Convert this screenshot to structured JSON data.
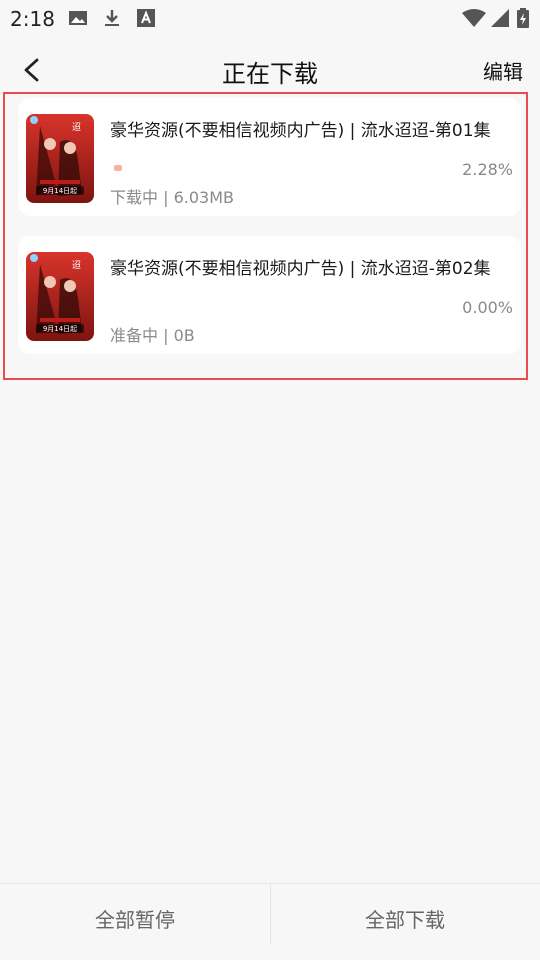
{
  "status_bar": {
    "time": "2:18",
    "icons": [
      "image-icon",
      "download-icon",
      "text-icon",
      "wifi-icon",
      "signal-icon",
      "battery-icon"
    ]
  },
  "header": {
    "title": "正在下载",
    "edit_label": "编辑",
    "back_icon": "chevron-left-icon"
  },
  "downloads": [
    {
      "title": "豪华资源(不要相信视频内广告) | 流水迢迢-第01集",
      "percent": "2.28%",
      "progress_fraction": 0.0228,
      "status": "下载中 | 6.03MB",
      "poster_badge": "9月14日起"
    },
    {
      "title": "豪华资源(不要相信视频内广告) | 流水迢迢-第02集",
      "percent": "0.00%",
      "progress_fraction": 0,
      "status": "准备中 | 0B",
      "poster_badge": "9月14日起"
    }
  ],
  "footer": {
    "pause_all": "全部暂停",
    "download_all": "全部下载"
  },
  "colors": {
    "highlight": "#e84c52",
    "progress": "#f5b39b",
    "poster_red": "#c1271f"
  }
}
